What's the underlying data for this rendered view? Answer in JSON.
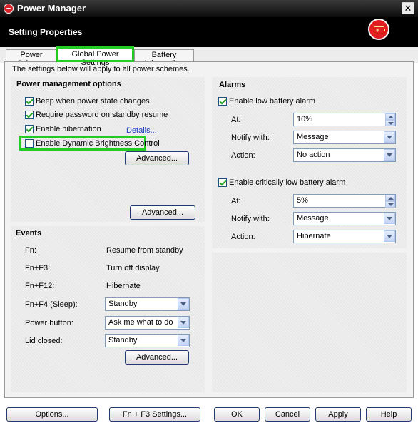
{
  "window": {
    "title": "Power Manager",
    "close_glyph": "✕"
  },
  "header": {
    "title": "Setting Properties",
    "icon": "battery-charging-icon",
    "accent_color": "#e21d22"
  },
  "tabs": [
    {
      "label": "Power Scheme"
    },
    {
      "label": "Global Power Settings",
      "selected": true
    },
    {
      "label": "Battery Information"
    }
  ],
  "intro_text": "The settings below will apply to all power schemes.",
  "power_options": {
    "title": "Power management options",
    "items": [
      {
        "label": "Beep when power state changes",
        "checked": true
      },
      {
        "label": "Require password on standby resume",
        "checked": true
      },
      {
        "label": "Enable hibernation",
        "checked": true
      },
      {
        "label": "Enable Dynamic Brightness Control",
        "checked": false
      }
    ],
    "details_link": "Details...",
    "advanced_label": "Advanced...",
    "advanced2_label": "Advanced..."
  },
  "alarms": {
    "title": "Alarms",
    "low": {
      "enable_label": "Enable low battery alarm",
      "checked": true,
      "at_label": "At:",
      "at_value": "10%",
      "notify_label": "Notify with:",
      "notify_value": "Message",
      "action_label": "Action:",
      "action_value": "No action"
    },
    "critical": {
      "enable_label": "Enable critically low battery alarm",
      "checked": true,
      "at_label": "At:",
      "at_value": "5%",
      "notify_label": "Notify with:",
      "notify_value": "Message",
      "action_label": "Action:",
      "action_value": "Hibernate"
    }
  },
  "events": {
    "title": "Events",
    "static_rows": [
      {
        "key": "Fn:",
        "value": "Resume from standby"
      },
      {
        "key": "Fn+F3:",
        "value": "Turn off display"
      },
      {
        "key": "Fn+F12:",
        "value": "Hibernate"
      }
    ],
    "select_rows": [
      {
        "key": "Fn+F4 (Sleep):",
        "value": "Standby"
      },
      {
        "key": "Power button:",
        "value": "Ask me what to do"
      },
      {
        "key": "Lid closed:",
        "value": "Standby"
      }
    ],
    "advanced_label": "Advanced..."
  },
  "footer": {
    "options": "Options...",
    "fnf3": "Fn + F3 Settings...",
    "ok": "OK",
    "cancel": "Cancel",
    "apply": "Apply",
    "help": "Help"
  }
}
